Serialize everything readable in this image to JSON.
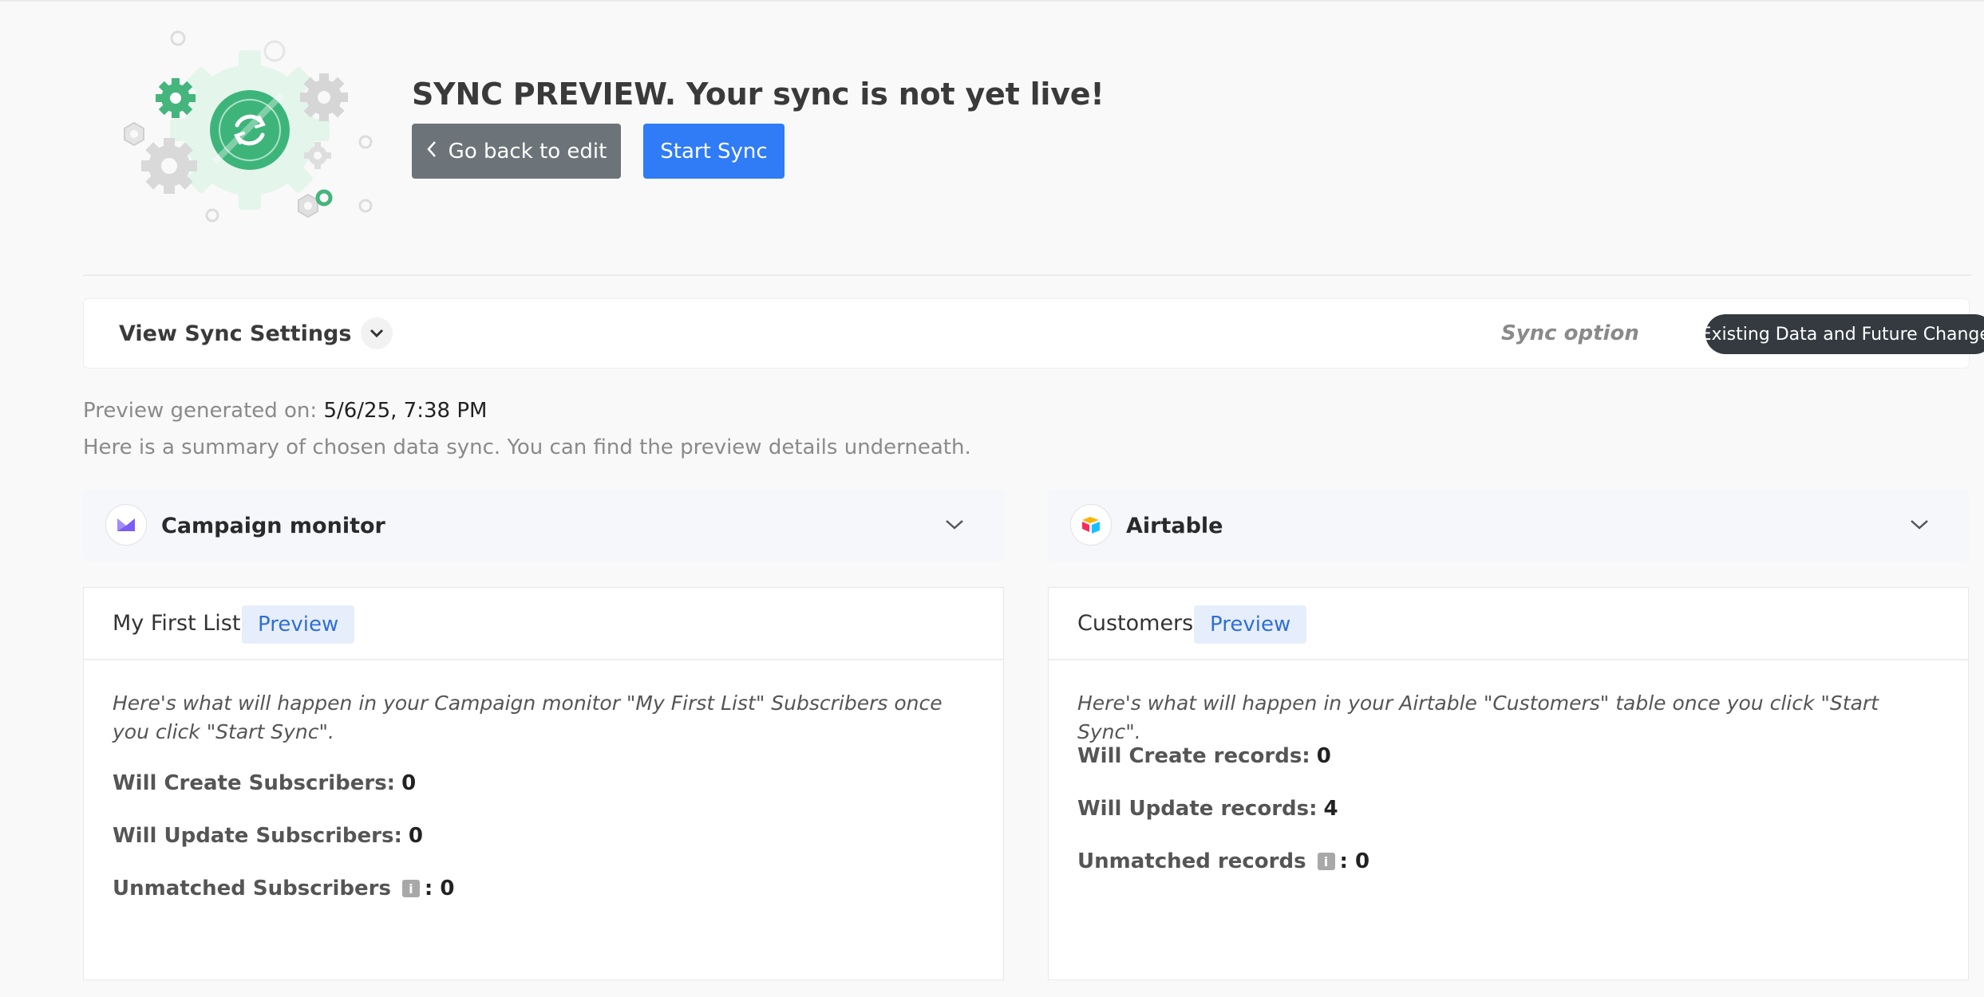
{
  "header": {
    "title": "SYNC PREVIEW. Your sync is not yet live!",
    "back_button": "Go back to edit",
    "start_button": "Start Sync"
  },
  "settings": {
    "toggle_label": "View Sync Settings",
    "sync_option_label": "Sync option",
    "sync_option_value": "Existing Data and Future Changes"
  },
  "summary": {
    "generated_label": "Preview generated on:",
    "generated_value": "5/6/25, 7:38 PM",
    "description": "Here is a summary of chosen data sync. You can find the preview details underneath."
  },
  "left_panel": {
    "app_name": "Campaign monitor",
    "list_name": "My First List",
    "preview_label": "Preview",
    "description": "Here's what will happen in your Campaign monitor \"My First List\" Subscribers once you click \"Start Sync\".",
    "create_label": "Will Create Subscribers:",
    "create_value": "0",
    "update_label": "Will Update Subscribers:",
    "update_value": "0",
    "unmatched_label": "Unmatched Subscribers",
    "unmatched_value": ": 0"
  },
  "right_panel": {
    "app_name": "Airtable",
    "list_name": "Customers",
    "preview_label": "Preview",
    "description": "Here's what will happen in your Airtable \"Customers\" table once you click \"Start Sync\".",
    "create_label": "Will Create records:",
    "create_value": "0",
    "update_label": "Will Update records:",
    "update_value": "4",
    "unmatched_label": "Unmatched records",
    "unmatched_value": ": 0"
  },
  "colors": {
    "accent_blue": "#2f7cf6",
    "back_gray": "#6c7479",
    "sync_green": "#3db57a",
    "badge_dark": "#343a40"
  },
  "icons": {
    "illustration": "sync-gears-icon",
    "back": "chevron-left-icon",
    "settings_toggle": "chevron-down-icon",
    "campaign_monitor": "campaign-monitor-logo",
    "airtable": "airtable-logo",
    "info": "info-icon"
  }
}
